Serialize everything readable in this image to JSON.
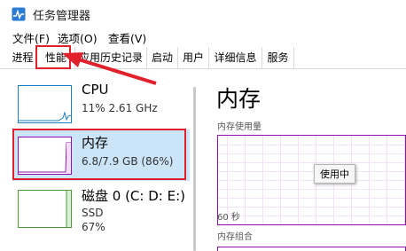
{
  "window": {
    "title": "任务管理器"
  },
  "menu": {
    "items": [
      "文件(F)",
      "选项(O)",
      "查看(V)"
    ]
  },
  "tabs": [
    "进程",
    "性能",
    "应用历史记录",
    "启动",
    "用户",
    "详细信息",
    "服务"
  ],
  "active_tab": "性能",
  "sidebar": {
    "items": [
      {
        "title": "CPU",
        "line1": "11% 2.61 GHz",
        "line2": "",
        "usage_percent": 11,
        "color": "#1a7fc0"
      },
      {
        "title": "内存",
        "line1": "6.8/7.9 GB (86%)",
        "line2": "",
        "usage_percent": 86,
        "color": "#8b12ae"
      },
      {
        "title": "磁盘 0 (C: D: E:)",
        "line1": "SSD",
        "line2": "67%",
        "usage_percent": 67,
        "color": "#4d9b3a"
      }
    ]
  },
  "detail": {
    "title": "内存",
    "usage_label": "内存使用量",
    "tooltip": "使用中",
    "time_label": "60 秒",
    "composition_label": "内存组合"
  },
  "colors": {
    "memory": "#8b12ae",
    "cpu": "#1a7fc0",
    "disk": "#4d9b3a",
    "highlight": "#e0202a",
    "selected": "#cce4f7"
  }
}
